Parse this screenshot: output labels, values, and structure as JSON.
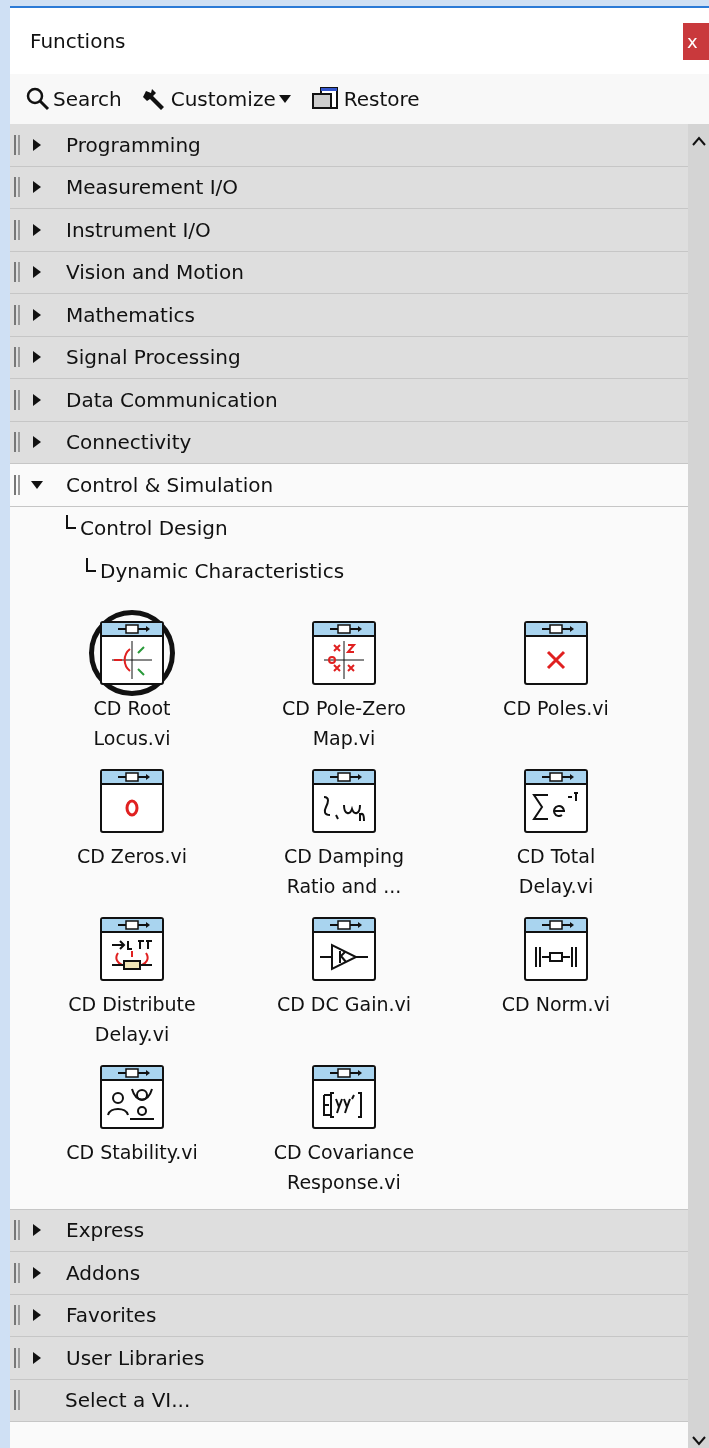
{
  "window": {
    "title": "Functions",
    "close": "x"
  },
  "toolbar": [
    {
      "kind": "search",
      "label": "Search"
    },
    {
      "kind": "customize",
      "label": "Customize"
    },
    {
      "kind": "restore",
      "label": "Restore"
    }
  ],
  "categories": [
    {
      "kind": "category",
      "label": "Programming",
      "expanded": false
    },
    {
      "kind": "category",
      "label": "Measurement I/O",
      "expanded": false
    },
    {
      "kind": "category",
      "label": "Instrument I/O",
      "expanded": false
    },
    {
      "kind": "category",
      "label": "Vision and Motion",
      "expanded": false
    },
    {
      "kind": "category",
      "label": "Mathematics",
      "expanded": false
    },
    {
      "kind": "category",
      "label": "Signal Processing",
      "expanded": false
    },
    {
      "kind": "category",
      "label": "Data Communication",
      "expanded": false
    },
    {
      "kind": "category",
      "label": "Connectivity",
      "expanded": false
    },
    {
      "kind": "category",
      "label": "Control & Simulation",
      "expanded": true,
      "children": [
        {
          "label": "Control Design",
          "children": [
            {
              "label": "Dynamic Characteristics",
              "functions": [
                {
                  "kind": "root_locus",
                  "label": "CD Root Locus.vi",
                  "selected": true
                },
                {
                  "kind": "pole_zero",
                  "label": "CD Pole-Zero Map.vi",
                  "selected": false
                },
                {
                  "kind": "poles",
                  "label": "CD Poles.vi",
                  "selected": false
                },
                {
                  "kind": "zeros",
                  "label": "CD Zeros.vi",
                  "selected": false
                },
                {
                  "kind": "damping",
                  "label": "CD Damping Ratio and ...",
                  "selected": false
                },
                {
                  "kind": "total_delay",
                  "label": "CD Total Delay.vi",
                  "selected": false
                },
                {
                  "kind": "distribute",
                  "label": "CD Distribute Delay.vi",
                  "selected": false
                },
                {
                  "kind": "gain",
                  "label": "CD DC Gain.vi",
                  "selected": false
                },
                {
                  "kind": "norm",
                  "label": "CD Norm.vi",
                  "selected": false
                },
                {
                  "kind": "stability",
                  "label": "CD Stability.vi",
                  "selected": false
                },
                {
                  "kind": "covariance",
                  "label": "CD Covariance Response.vi",
                  "selected": false
                }
              ]
            }
          ]
        }
      ]
    },
    {
      "kind": "category",
      "label": "Express",
      "expanded": false
    },
    {
      "kind": "category",
      "label": "Addons",
      "expanded": false
    },
    {
      "kind": "category",
      "label": "Favorites",
      "expanded": false
    },
    {
      "kind": "category",
      "label": "User Libraries",
      "expanded": false
    },
    {
      "kind": "action",
      "label": "Select a VI..."
    }
  ]
}
